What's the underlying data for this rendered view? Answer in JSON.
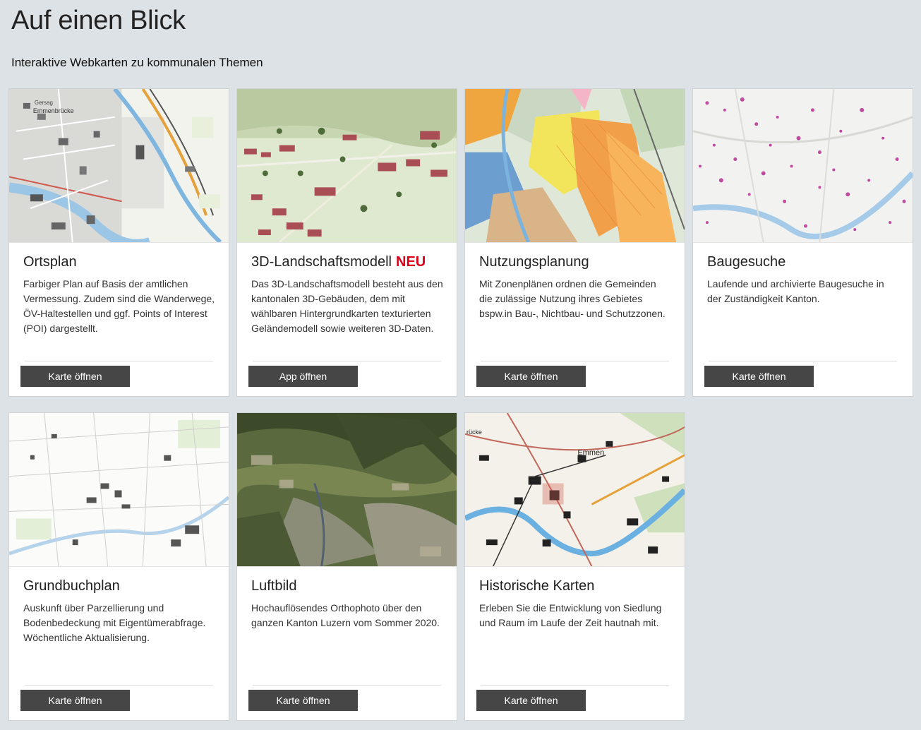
{
  "page": {
    "title": "Auf einen Blick",
    "subtitle": "Interaktive Webkarten zu kommunalen Themen"
  },
  "cards": [
    {
      "title": "Ortsplan",
      "badge": "",
      "text": "Farbiger Plan auf Basis der amtlichen Vermessung. Zudem sind die Wanderwege, ÖV-Haltestellen und ggf. Points of Interest (POI) dargestellt.",
      "button": "Karte öffnen",
      "image": "city-street-map"
    },
    {
      "title": "3D-Landschaftsmodell",
      "badge": "NEU",
      "text": "Das 3D-Landschaftsmodell besteht aus den kantonalen 3D-Gebäuden, dem mit wählbaren Hintergrundkarten texturierten Geländemodell sowie weiteren 3D-Daten.",
      "button": "App öffnen",
      "image": "3d-landscape-view"
    },
    {
      "title": "Nutzungsplanung",
      "badge": "",
      "text": "Mit Zonenplänen ordnen die Gemeinden die zulässige Nutzung ihres Gebietes bspw.in  Bau-, Nichtbau- und Schutzzonen.",
      "button": "Karte öffnen",
      "image": "zoning-map"
    },
    {
      "title": "Baugesuche",
      "badge": "",
      "text": "Laufende und archivierte Baugesuche in der Zuständigkeit Kanton.",
      "button": "Karte öffnen",
      "image": "building-permits-map"
    },
    {
      "title": "Grundbuchplan",
      "badge": "",
      "text": "Auskunft über Parzellierung und Bodenbedeckung mit Eigentümerabfrage. Wöchentliche Aktualisierung.",
      "button": "Karte öffnen",
      "image": "land-register-map"
    },
    {
      "title": "Luftbild",
      "badge": "",
      "text": "Hochauflösendes Orthophoto über den ganzen Kanton Luzern vom Sommer 2020.",
      "button": "Karte öffnen",
      "image": "aerial-photo"
    },
    {
      "title": "Historische Karten",
      "badge": "",
      "text": "Erleben Sie die Entwicklung von Siedlung und Raum im Laufe der Zeit hautnah mit.",
      "button": "Karte öffnen",
      "image": "historic-topo-map"
    }
  ],
  "map_labels": {
    "card1": [
      "Gersag",
      "Emmenbrücke"
    ],
    "card7": [
      "Emmen",
      "rücke"
    ]
  },
  "colors": {
    "page_background": "#dde2e6",
    "button_background": "#464646",
    "badge_new": "#d9001b"
  }
}
